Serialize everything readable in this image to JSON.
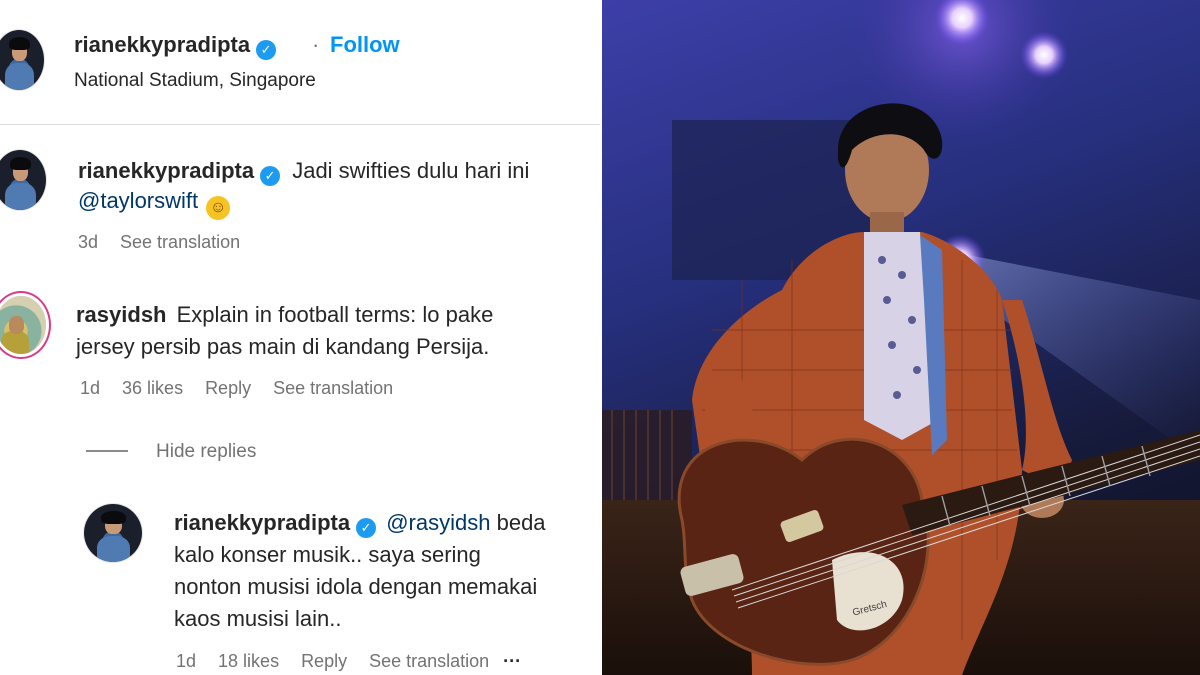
{
  "post_header": {
    "username": "rianekkypradipta",
    "separator": "·",
    "follow_label": "Follow",
    "location": "National Stadium, Singapore"
  },
  "caption": {
    "username": "rianekkypradipta",
    "text": "Jadi swifties dulu hari ini",
    "mention": "@taylorswift",
    "emoji": "😀",
    "time": "3d",
    "translate": "See translation"
  },
  "comment": {
    "username": "rasyidsh",
    "text_line1": "Explain in football terms: lo pake",
    "text_line2": "jersey persib pas main di kandang Persija.",
    "time": "1d",
    "likes": "36 likes",
    "reply": "Reply",
    "translate": "See translation"
  },
  "hide_replies": "Hide replies",
  "reply": {
    "username": "rianekkypradipta",
    "mention": "@rasyidsh",
    "text_first": "beda",
    "text_line2": "kalo konser musik.. saya sering",
    "text_line3": "nonton musisi idola dengan memakai",
    "text_line4": "kaos musisi lain..",
    "time": "1d",
    "likes": "18 likes",
    "reply": "Reply",
    "translate": "See translation",
    "more": "···"
  },
  "photo": {
    "guitar_label": "Gretsch"
  },
  "colors": {
    "follow_blue": "#0095f6",
    "verified_blue": "#1d9bf0",
    "mention_blue": "#00376b",
    "story_ring": "#d93b86"
  }
}
